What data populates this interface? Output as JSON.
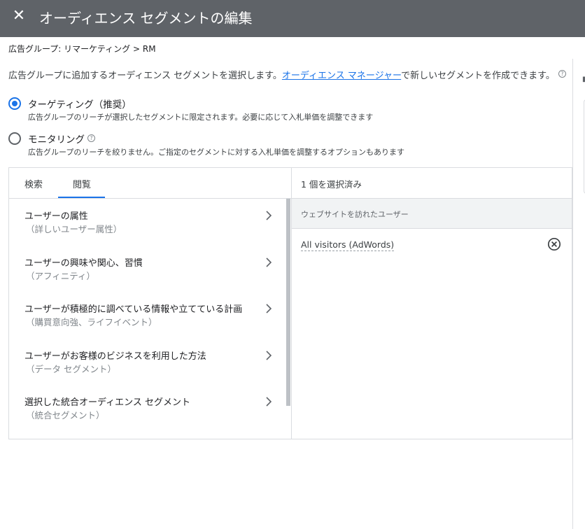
{
  "header": {
    "close_icon": "close-icon",
    "title": "オーディエンス セグメントの編集"
  },
  "breadcrumb": "広告グループ: リマーケティング > RM",
  "description": {
    "before": "広告グループに追加するオーディエンス セグメントを選択します。",
    "link": "オーディエンス マネージャー",
    "after": "で新しいセグメントを作成できます。",
    "help_icon": "help-icon"
  },
  "options": [
    {
      "label": "ターゲティング（推奨）",
      "sub": "広告グループのリーチが選択したセグメントに限定されます。必要に応じて入札単価を調整できます",
      "selected": true
    },
    {
      "label": "モニタリング",
      "sub": "広告グループのリーチを絞りません。ご指定のセグメントに対する入札単価を調整するオプションもあります",
      "selected": false
    }
  ],
  "tabs": [
    {
      "label": "検索",
      "active": false
    },
    {
      "label": "閲覧",
      "active": true
    }
  ],
  "categories": [
    {
      "title": "ユーザーの属性",
      "sub": "（詳しいユーザー属性）"
    },
    {
      "title": "ユーザーの興味や関心、習慣",
      "sub": "（アフィニティ）"
    },
    {
      "title": "ユーザーが積極的に調べている情報や立てている計画",
      "sub": "（購買意向強、ライフイベント）"
    },
    {
      "title": "ユーザーがお客様のビジネスを利用した方法",
      "sub": "（データ セグメント）"
    },
    {
      "title": "選択した統合オーディエンス セグメント",
      "sub": "（統合セグメント）"
    }
  ],
  "selection": {
    "count_label": "1 個を選択済み",
    "group_label": "ウェブサイトを訪れたユーザー",
    "items": [
      {
        "label": "All visitors (AdWords)",
        "remove_icon": "remove-circle-icon"
      }
    ]
  },
  "colors": {
    "header_bg": "#5f6368",
    "accent": "#1a73e8",
    "link": "#1a73e8"
  }
}
